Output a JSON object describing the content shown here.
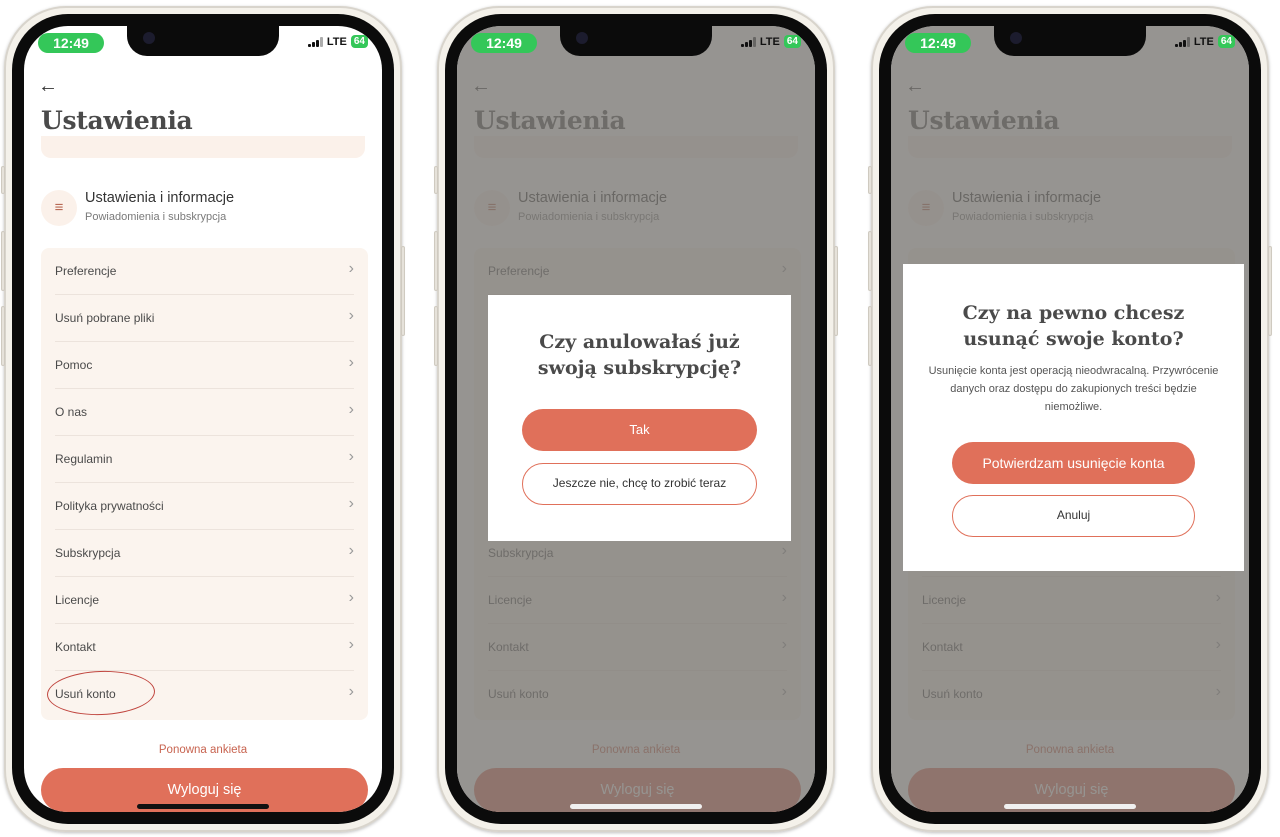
{
  "status": {
    "time": "12:49",
    "network": "LTE",
    "battery": "64"
  },
  "header": {
    "title": "Ustawienia"
  },
  "settings_card": {
    "title": "Ustawienia i informacje",
    "subtitle": "Powiadomienia i subskrypcja",
    "icon": "sliders-icon"
  },
  "menu": [
    {
      "label": "Preferencje"
    },
    {
      "label": "Usuń pobrane pliki"
    },
    {
      "label": "Pomoc"
    },
    {
      "label": "O nas"
    },
    {
      "label": "Regulamin"
    },
    {
      "label": "Polityka prywatności"
    },
    {
      "label": "Subskrypcja"
    },
    {
      "label": "Licencje"
    },
    {
      "label": "Kontakt"
    },
    {
      "label": "Usuń konto"
    }
  ],
  "footer": {
    "retake_survey": "Ponowna ankieta",
    "logout": "Wyloguj się"
  },
  "dialog_cancel_sub": {
    "question": "Czy anulowałaś już swoją subskrypcję?",
    "yes": "Tak",
    "not_yet": "Jeszcze nie, chcę to zrobić teraz"
  },
  "dialog_delete": {
    "question": "Czy na pewno chcesz usunąć swoje konto?",
    "description": "Usunięcie konta jest operacją nieodwracalną. Przywrócenie danych oraz dostępu do zakupionych treści będzie niemożliwe.",
    "confirm": "Potwierdzam usunięcie konta",
    "cancel": "Anuluj"
  },
  "colors": {
    "accent": "#e0705a",
    "card_bg": "#fbf4ee",
    "status_green": "#34c759"
  }
}
